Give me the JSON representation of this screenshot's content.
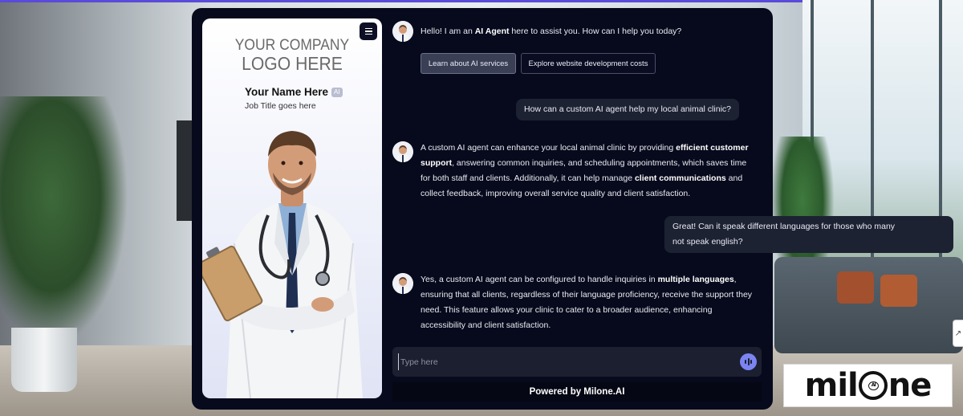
{
  "profile": {
    "logo_line1": "YOUR COMPANY",
    "logo_line2": "LOGO HERE",
    "name": "Your Name Here",
    "name_badge": "AI",
    "job_title": "Job Title goes here"
  },
  "chat": {
    "greeting": {
      "text_before": "Hello! I am an ",
      "bold": "AI Agent",
      "text_after": " here to assist you. How can I help you today?"
    },
    "quick_replies": [
      "Learn about AI services",
      "Explore website development costs"
    ],
    "user_messages": [
      "How can a custom AI agent help my local animal clinic?",
      "Great! Can it speak different languages for those who many not speak english?"
    ],
    "bot_reply_1": {
      "p1": "A custom AI agent can enhance your local animal clinic by providing ",
      "b1": "efficient customer support",
      "p2": ", answering common inquiries, and scheduling appointments, which saves time for both staff and clients. Additionally, it can help manage ",
      "b2": "client communications",
      "p3": " and collect feedback, improving overall service quality and client satisfaction."
    },
    "bot_reply_2": {
      "p1": "Yes, a custom AI agent can be configured to handle inquiries in ",
      "b1": "multiple languages",
      "p2": ", ensuring that all clients, regardless of their language proficiency, receive the support they need. This feature allows your clinic to cater to a broader audience, enhancing accessibility and client satisfaction."
    }
  },
  "input": {
    "placeholder": "Type here"
  },
  "footer": {
    "powered_by": "Powered by Milone.AI"
  },
  "brand": {
    "name_pre": "mil",
    "name_post": "ne",
    "o_badge": "AI"
  },
  "colors": {
    "widget_bg": "#070a1c",
    "accent": "#7b84f0",
    "bubble": "#1d2233"
  }
}
